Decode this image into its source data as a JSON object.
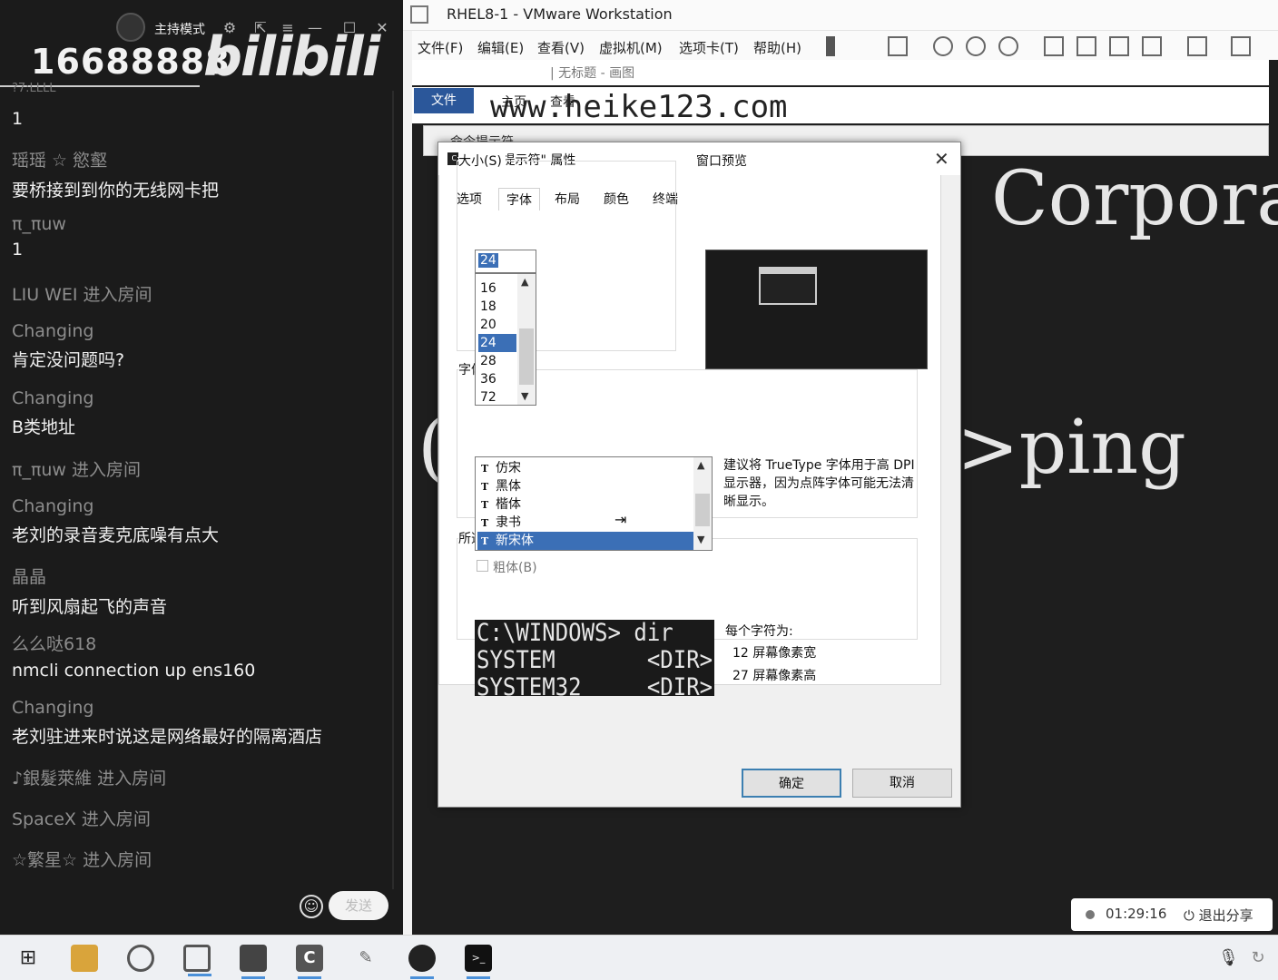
{
  "chat": {
    "room_number": "16688888",
    "logo": "bilibili",
    "mode_label": "主持模式",
    "header_partial": "?7:LLLL",
    "first_line": "1",
    "messages": [
      {
        "user": "瑶瑶 ☆ 慾壑",
        "text": "要桥接到到你的无线网卡把"
      },
      {
        "user": "π_πuw",
        "text": "1"
      },
      {
        "user": "LIU WEI",
        "join": "进入房间"
      },
      {
        "user": "Changing",
        "text": "肯定没问题吗?"
      },
      {
        "user": "Changing",
        "text": "B类地址"
      },
      {
        "user": "π_πuw",
        "join": "进入房间"
      },
      {
        "user": "Changing",
        "text": "老刘的录音麦克底噪有点大"
      },
      {
        "user": "晶晶",
        "text": "听到风扇起飞的声音"
      },
      {
        "user": "么么哒618",
        "text": "nmcli connection up ens160"
      },
      {
        "user": "Changing",
        "text": "老刘驻进来时说这是网络最好的隔离酒店"
      },
      {
        "user": "♪銀髮萊維",
        "join": "进入房间"
      },
      {
        "user": "SpaceX",
        "join": "进入房间"
      },
      {
        "user": "☆繁星☆",
        "join": "进入房间"
      }
    ],
    "send_label": "发送"
  },
  "vmware": {
    "title": "RHEL8-1 - VMware Workstation",
    "menus": [
      "文件(F)",
      "编辑(E)",
      "查看(V)",
      "虚拟机(M)",
      "选项卡(T)",
      "帮助(H)"
    ],
    "paint_title": "| 无标题 - 画图",
    "paint_file_tab": "文件",
    "paint_tabs": [
      "主页",
      "查看"
    ],
    "watermark": "www.heike123.com",
    "cmd_title": "命令提示符",
    "console_text_1": "Corpora",
    "console_text_2": ">ping",
    "console_text_3": "("
  },
  "dialog": {
    "title": "\"命令提示符\" 属性",
    "tabs": [
      "选项",
      "字体",
      "布局",
      "颜色",
      "终端"
    ],
    "active_tab": "字体",
    "size_label": "大小(S)",
    "size_value": "24",
    "sizes": [
      "16",
      "18",
      "20",
      "24",
      "28",
      "36",
      "72"
    ],
    "selected_size": "24",
    "preview_label": "窗口预览",
    "font_label": "字体(F)",
    "fonts": [
      "仿宋",
      "黑体",
      "楷体",
      "隶书",
      "新宋体"
    ],
    "selected_font": "新宋体",
    "truetype_hint": "建议将 TrueType 字体用于高 DPI 显示器，因为点阵字体可能无法清晰显示。",
    "bold_label": "粗体(B)",
    "selected_font_label": "所选字体: 新宋体",
    "sample_lines": [
      "C:\\WINDOWS> dir",
      "SYSTEM       <DIR>",
      "SYSTEM32     <DIR>"
    ],
    "char_size_label": "每个字符为:",
    "char_width": "12 屏幕像素宽",
    "char_height": "27 屏幕像素高",
    "ok_label": "确定",
    "cancel_label": "取消"
  },
  "share": {
    "time": "01:29:16",
    "exit_label": "退出分享"
  },
  "taskbar": {
    "items": [
      "start-icon",
      "file-explorer-icon",
      "browser-icon",
      "vmware-icon",
      "monitor-icon",
      "app-c-icon",
      "feather-icon",
      "avatar-icon",
      "terminal-icon"
    ],
    "tray": [
      "microphone-icon",
      "sync-icon"
    ]
  }
}
